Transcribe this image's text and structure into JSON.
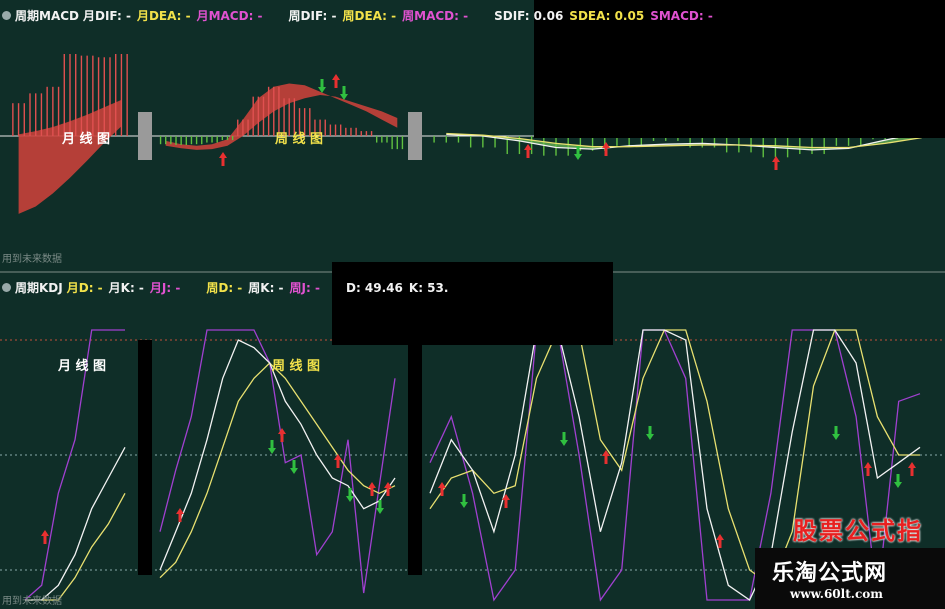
{
  "macd_header": {
    "title": "周期MACD",
    "items": [
      {
        "label": "月DIF:",
        "value": "-",
        "color": "#f2f2f2"
      },
      {
        "label": "月DEA:",
        "value": "-",
        "color": "#f2e24a"
      },
      {
        "label": "月MACD:",
        "value": "-",
        "color": "#e052d0"
      },
      {
        "label": "周DIF:",
        "value": "-",
        "color": "#f2f2f2"
      },
      {
        "label": "周DEA:",
        "value": "-",
        "color": "#f2e24a"
      },
      {
        "label": "周MACD:",
        "value": "-",
        "color": "#e052d0"
      },
      {
        "label": "SDIF:",
        "value": "0.06",
        "color": "#f2f2f2"
      },
      {
        "label": "SDEA:",
        "value": "0.05",
        "color": "#f2e24a"
      },
      {
        "label": "SMACD:",
        "value": "-",
        "color": "#e052d0"
      }
    ]
  },
  "kdj_header": {
    "title": "周期KDJ",
    "items": [
      {
        "label": "月D:",
        "value": "-",
        "color": "#f2e24a"
      },
      {
        "label": "月K:",
        "value": "-",
        "color": "#f2f2f2"
      },
      {
        "label": "月J:",
        "value": "-",
        "color": "#e052d0"
      },
      {
        "label": "周D:",
        "value": "-",
        "color": "#f2e24a"
      },
      {
        "label": "周K:",
        "value": "-",
        "color": "#f2f2f2"
      },
      {
        "label": "周J:",
        "value": "-",
        "color": "#e052d0"
      },
      {
        "label": "D:",
        "value": "49.46",
        "color": "#f2f2f2"
      },
      {
        "label": "K:",
        "value": "53.",
        "color": "#f2f2f2"
      }
    ]
  },
  "labels": {
    "month_macd": "月 线 图",
    "week_macd": "周 线 图",
    "month_kdj": "月 线 图",
    "week_kdj": "周 线 图",
    "future_top": "用到未来数据",
    "future_bottom": "用到未来数据"
  },
  "watermark": {
    "title": "乐淘公式网",
    "url": "www.60lt.com",
    "red_text": "股票公式指标网"
  },
  "colors": {
    "background": "#0f2e28",
    "k_line": "#f2f2f2",
    "d_line": "#e8e070",
    "j_line": "#a040d0",
    "up_arrow": "#e83030",
    "down_arrow": "#30c040",
    "macd_bull": "#c8413a",
    "macd_bear": "#5aa050"
  },
  "chart_data": [
    {
      "type": "line",
      "title": "周期MACD",
      "panels": [
        {
          "name": "月",
          "dif": [
            0.2,
            0.6,
            1.1,
            1.8,
            2.6,
            3.5,
            4.4
          ],
          "dea": [
            -9.5,
            -8.6,
            -7.0,
            -5.1,
            -3.0,
            -0.8,
            1.2
          ],
          "macd": [
            4.0,
            5.2,
            6.0,
            10.0,
            9.8,
            9.6,
            10.0
          ]
        },
        {
          "name": "周",
          "dif": [
            -0.6,
            -1.0,
            -1.2,
            -1.0,
            -0.4,
            2.0,
            4.6,
            6.0,
            6.4,
            6.2,
            5.4,
            4.6,
            3.8,
            3.0,
            2.0,
            1.0
          ],
          "dea": [
            -1.2,
            -1.5,
            -1.7,
            -1.6,
            -1.2,
            0.0,
            1.6,
            3.0,
            4.0,
            4.6,
            5.0,
            4.8,
            4.2,
            3.6,
            3.0,
            2.2
          ],
          "macd": [
            -1.0,
            -1.1,
            -1.0,
            -0.8,
            -0.5,
            2.0,
            4.8,
            6.0,
            4.6,
            3.4,
            2.0,
            1.4,
            1.0,
            0.6,
            -0.8,
            -1.6
          ]
        },
        {
          "name": "日",
          "dif": [
            0.2,
            0.0,
            -0.6,
            -1.4,
            -1.6,
            -1.2,
            -1.0,
            -0.9,
            -1.1,
            -1.4,
            -1.7,
            -1.5,
            -0.5,
            0.4
          ],
          "dea": [
            0.3,
            0.1,
            -0.3,
            -0.9,
            -1.3,
            -1.3,
            -1.2,
            -1.1,
            -1.1,
            -1.2,
            -1.4,
            -1.4,
            -0.9,
            -0.2
          ],
          "macd": [
            -0.8,
            -1.4,
            -2.2,
            -2.4,
            -1.8,
            -1.2,
            -0.6,
            -1.4,
            -2.0,
            -2.6,
            -2.2,
            -1.2,
            -0.4,
            0.2
          ]
        }
      ],
      "ylim": [
        -10,
        11
      ]
    },
    {
      "type": "line",
      "title": "周期KDJ",
      "panels": [
        {
          "name": "月",
          "k": [
            6,
            8,
            16,
            24,
            36,
            44,
            52
          ],
          "d": [
            4,
            6,
            12,
            18,
            26,
            32,
            40
          ],
          "j": [
            10,
            16,
            40,
            54,
            110,
            104,
            96
          ]
        },
        {
          "name": "周",
          "k": [
            20,
            30,
            40,
            54,
            70,
            80,
            78,
            74,
            64,
            58,
            50,
            44,
            42,
            36,
            38,
            44
          ],
          "d": [
            18,
            22,
            30,
            40,
            52,
            64,
            70,
            74,
            70,
            64,
            58,
            52,
            46,
            42,
            40,
            42
          ],
          "j": [
            30,
            46,
            60,
            90,
            150,
            105,
            92,
            74,
            48,
            50,
            24,
            30,
            54,
            14,
            42,
            70
          ]
        },
        {
          "name": "日",
          "k": [
            40,
            54,
            46,
            30,
            50,
            108,
            112,
            60,
            30,
            48,
            96,
            106,
            80,
            36,
            16,
            10,
            24,
            56,
            110,
            104,
            74,
            44,
            48,
            52
          ],
          "d": [
            36,
            44,
            46,
            40,
            42,
            70,
            94,
            82,
            54,
            46,
            70,
            92,
            92,
            64,
            36,
            20,
            16,
            30,
            68,
            90,
            86,
            60,
            50,
            50
          ],
          "j": [
            48,
            60,
            40,
            -20,
            20,
            160,
            150,
            50,
            -4,
            20,
            160,
            150,
            70,
            -20,
            -20,
            -10,
            40,
            150,
            180,
            120,
            60,
            10,
            64,
            66
          ]
        }
      ],
      "reference_lines": [
        20,
        50,
        80
      ],
      "ylim": [
        -20,
        120
      ]
    }
  ]
}
